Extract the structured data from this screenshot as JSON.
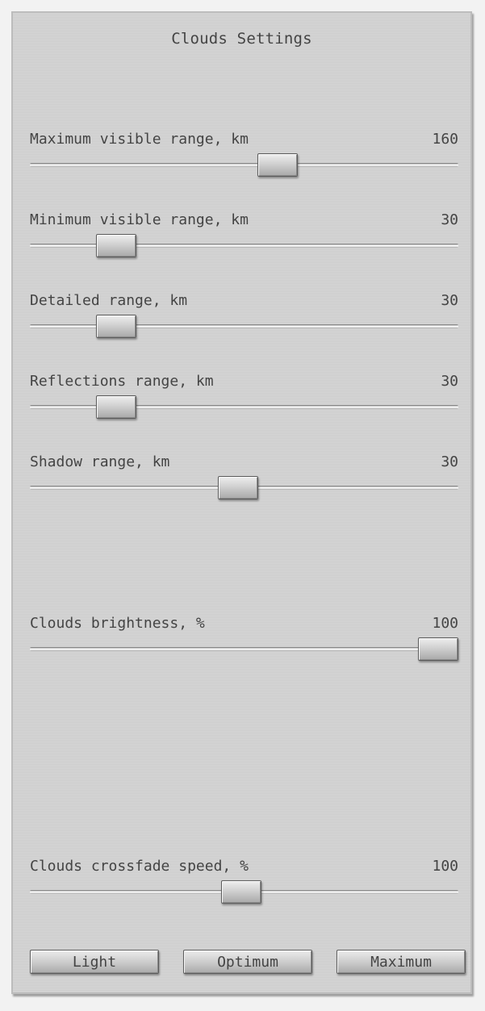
{
  "title": "Clouds Settings",
  "sliders": [
    {
      "label": "Maximum visible range, km",
      "value": "160",
      "level": 0.586
    },
    {
      "label": "Minimum visible range, km",
      "value": "30",
      "level": 0.171
    },
    {
      "label": "Detailed range, km",
      "value": "30",
      "level": 0.171
    },
    {
      "label": "Reflections range, km",
      "value": "30",
      "level": 0.171
    },
    {
      "label": "Shadow range, km",
      "value": "30",
      "level": 0.485
    },
    {
      "label": "Clouds brightness, %",
      "value": "100",
      "level": 1.0
    },
    {
      "label": "Clouds crossfade speed, %",
      "value": "100",
      "level": 0.492
    }
  ],
  "buttons": {
    "light": "Light",
    "optimum": "Optimum",
    "maximum": "Maximum"
  }
}
